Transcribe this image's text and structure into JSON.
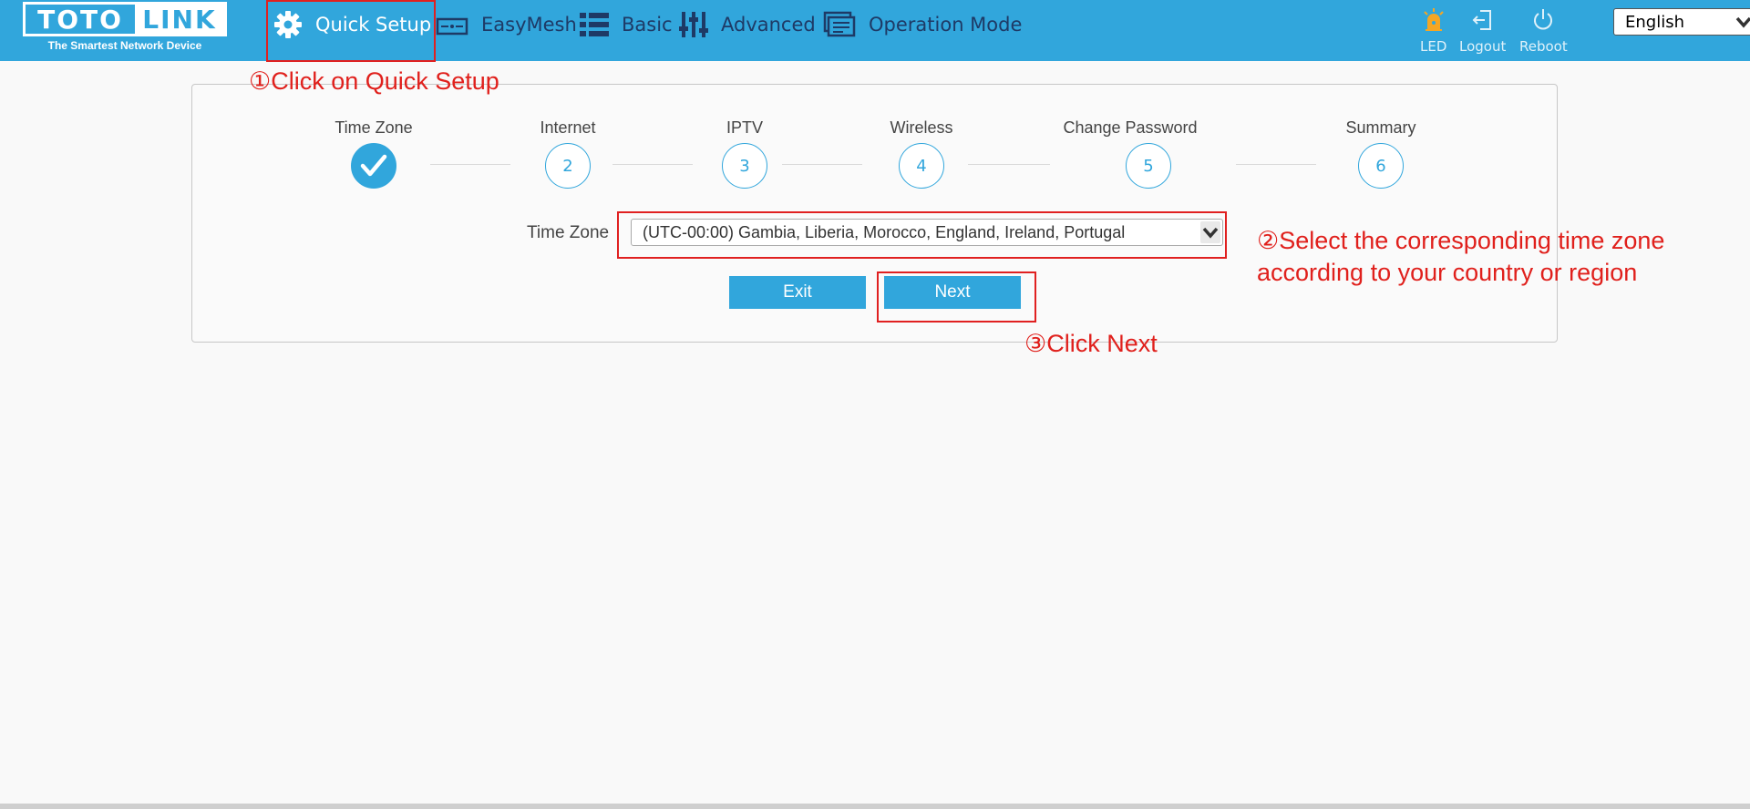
{
  "header": {
    "logo_left": "TOTO",
    "logo_right": "LINK",
    "tagline": "The Smartest Network Device",
    "nav": [
      {
        "label": "Quick Setup",
        "icon": "gear-icon",
        "active": true
      },
      {
        "label": "EasyMesh",
        "icon": "router-icon"
      },
      {
        "label": "Basic",
        "icon": "list-icon"
      },
      {
        "label": "Advanced",
        "icon": "sliders-icon"
      },
      {
        "label": "Operation Mode",
        "icon": "layers-icon"
      }
    ],
    "tools": [
      {
        "label": "LED",
        "icon": "led-icon"
      },
      {
        "label": "Logout",
        "icon": "logout-icon"
      },
      {
        "label": "Reboot",
        "icon": "power-icon"
      }
    ],
    "language": "English"
  },
  "wizard": {
    "steps": [
      {
        "label": "Time Zone",
        "number": "",
        "done": true
      },
      {
        "label": "Internet",
        "number": "2"
      },
      {
        "label": "IPTV",
        "number": "3"
      },
      {
        "label": "Wireless",
        "number": "4"
      },
      {
        "label": "Change Password",
        "number": "5"
      },
      {
        "label": "Summary",
        "number": "6"
      }
    ],
    "timezone_label": "Time Zone",
    "timezone_value": "(UTC-00:00) Gambia, Liberia, Morocco, England, Ireland, Portugal",
    "exit_label": "Exit",
    "next_label": "Next"
  },
  "annotations": {
    "step1": "①Click on Quick Setup",
    "step2_line1": "②Select the corresponding time zone",
    "step2_line2": "according to your country or region",
    "step3": "③Click Next"
  },
  "colors": {
    "header": "#31a6dc",
    "accent": "#31a6dc",
    "annotation": "#e0201c"
  }
}
